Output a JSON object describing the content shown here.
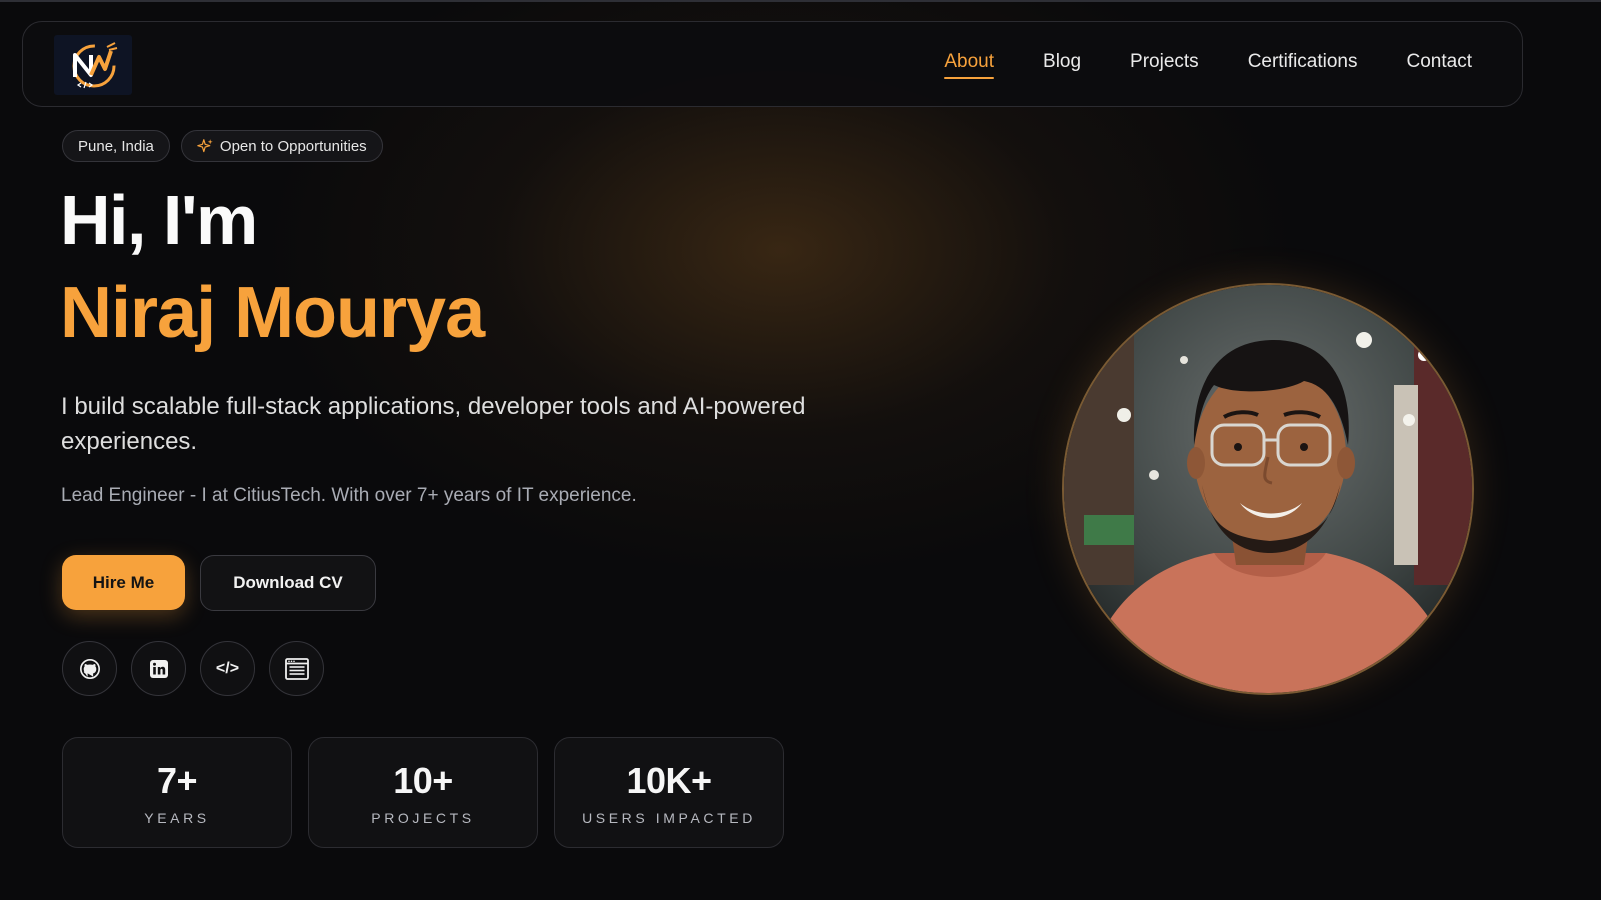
{
  "nav": {
    "items": [
      {
        "label": "About",
        "active": true
      },
      {
        "label": "Blog",
        "active": false
      },
      {
        "label": "Projects",
        "active": false
      },
      {
        "label": "Certifications",
        "active": false
      },
      {
        "label": "Contact",
        "active": false
      }
    ]
  },
  "hero": {
    "chips": [
      {
        "label": "Pune, India",
        "icon": null
      },
      {
        "label": "Open to Opportunities",
        "icon": "sparkle-icon"
      }
    ],
    "greeting": "Hi, I'm",
    "name": "Niraj Mourya",
    "tagline": "I build scalable full-stack applications, developer tools and AI-powered experiences.",
    "subline": "Lead Engineer - I at CitiusTech. With over 7+ years of IT experience.",
    "buttons": {
      "hire": "Hire Me",
      "download_cv": "Download CV"
    },
    "socials": [
      {
        "icon": "github-icon"
      },
      {
        "icon": "linkedin-icon"
      },
      {
        "icon": "code-icon",
        "glyph": "</>"
      },
      {
        "icon": "browser-window-icon"
      }
    ]
  },
  "stats": [
    {
      "value": "7+",
      "label": "YEARS"
    },
    {
      "value": "10+",
      "label": "PROJECTS"
    },
    {
      "value": "10K+",
      "label": "USERS IMPACTED"
    }
  ],
  "theme": {
    "accent": "#f7a23c",
    "background": "#0a0a0c"
  }
}
